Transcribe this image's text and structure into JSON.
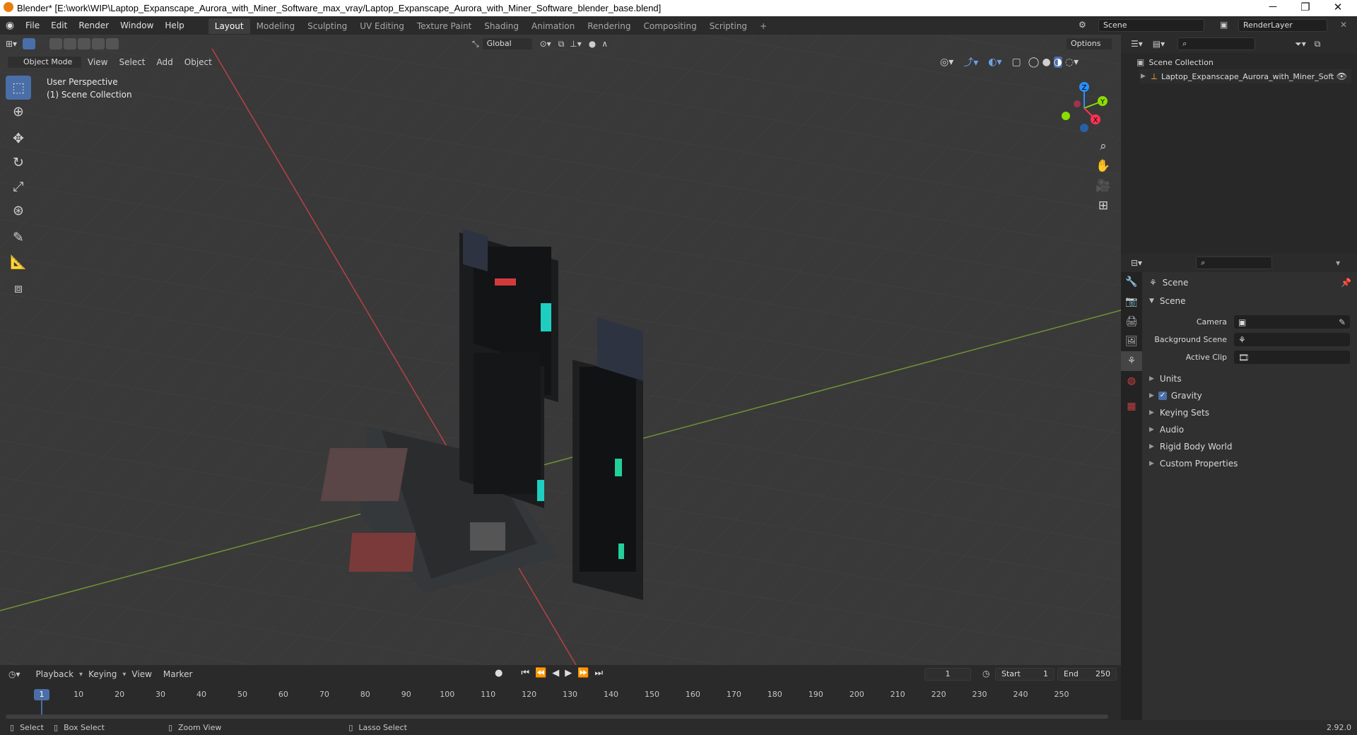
{
  "window": {
    "title": "Blender* [E:\\work\\WIP\\Laptop_Expanscape_Aurora_with_Miner_Software_max_vray/Laptop_Expanscape_Aurora_with_Miner_Software_blender_base.blend]",
    "minimize": "─",
    "restore": "❐",
    "close": "✕"
  },
  "menu": [
    "File",
    "Edit",
    "Render",
    "Window",
    "Help"
  ],
  "workspaces": [
    "Layout",
    "Modeling",
    "Sculpting",
    "UV Editing",
    "Texture Paint",
    "Shading",
    "Animation",
    "Rendering",
    "Compositing",
    "Scripting"
  ],
  "active_workspace": "Layout",
  "add_workspace": "+",
  "scene_field": "Scene",
  "renderlayer_field": "RenderLayer",
  "viewport": {
    "mode": "Object Mode",
    "menus": [
      "View",
      "Select",
      "Add",
      "Object"
    ],
    "transform_orientation": "Global",
    "options": "Options",
    "perspective_label": "User Perspective",
    "collection_label": "(1) Scene Collection",
    "gizmo_axes": {
      "x": "X",
      "y": "Y",
      "z": "Z"
    }
  },
  "outliner": {
    "root": "Scene Collection",
    "item": "Laptop_Expanscape_Aurora_with_Miner_Soft"
  },
  "properties": {
    "context": "Scene",
    "panel_title": "Scene",
    "camera_label": "Camera",
    "background_scene_label": "Background Scene",
    "active_clip_label": "Active Clip",
    "sections": [
      "Units",
      "Gravity",
      "Keying Sets",
      "Audio",
      "Rigid Body World",
      "Custom Properties"
    ],
    "gravity_checked": true
  },
  "timeline": {
    "menus": [
      "Playback",
      "Keying",
      "View",
      "Marker"
    ],
    "current_frame": "1",
    "start_label": "Start",
    "start_value": "1",
    "end_label": "End",
    "end_value": "250",
    "ticks": [
      "1",
      "10",
      "20",
      "30",
      "40",
      "50",
      "60",
      "70",
      "80",
      "90",
      "100",
      "110",
      "120",
      "130",
      "140",
      "150",
      "160",
      "170",
      "180",
      "190",
      "200",
      "210",
      "220",
      "230",
      "240",
      "250"
    ]
  },
  "statusbar": {
    "select": "Select",
    "box_select": "Box Select",
    "zoom_view": "Zoom View",
    "lasso_select": "Lasso Select",
    "version": "2.92.0"
  },
  "colors": {
    "accent": "#4a6ea8",
    "x_axis": "#ff3352",
    "y_axis": "#8bdc00",
    "z_axis": "#2890ff",
    "grid": "#434343"
  }
}
